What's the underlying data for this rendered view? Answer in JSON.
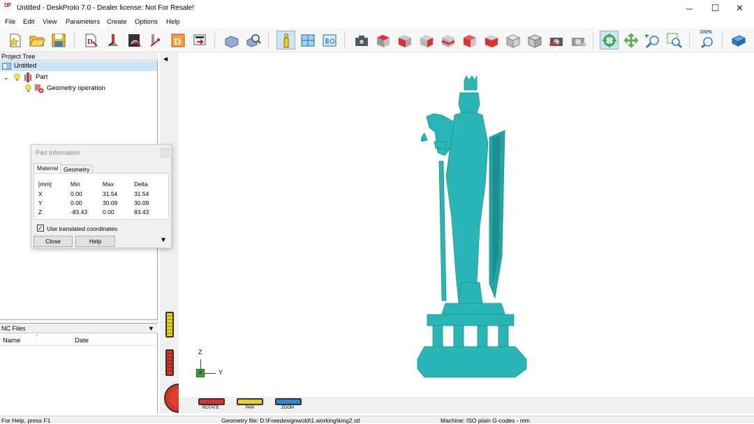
{
  "window": {
    "app_icon": "DP",
    "title": "Untitled - DeskProto 7.0 - Dealer license: Not For Resale!",
    "minimize": "─",
    "maximize": "☐",
    "close": "✕"
  },
  "menu": [
    "File",
    "Edit",
    "View",
    "Parameters",
    "Create",
    "Options",
    "Help"
  ],
  "toolbar": {
    "groups": [
      [
        "new-project-icon",
        "open-icon",
        "save-icon"
      ],
      [
        "wizard-icon",
        "wizard-2d-icon",
        "wizard-3d-icon",
        "wizard-rotary-icon",
        "decor-icon",
        "send-icon"
      ],
      [
        "part-icon",
        "find-icon"
      ],
      [
        "info-icon",
        "layout-icon",
        "window-icon"
      ],
      [
        "camera-icon",
        "view-top-icon",
        "view-front-icon",
        "view-left-icon",
        "view-right-icon",
        "view-back-icon",
        "view-bottom-icon",
        "view-iso-icon",
        "view-iso-2-icon",
        "view-previous-icon",
        "view-next-icon"
      ],
      [
        "rotate-icon",
        "pan-icon",
        "zoom-in-icon",
        "zoom-window-icon"
      ],
      [
        "zoom-100-icon"
      ],
      [
        "help-book-icon"
      ]
    ],
    "zoom_label": "100%",
    "active_icon": "info-icon"
  },
  "project_tree": {
    "header": "Project Tree",
    "root": "Untitled",
    "part": "Part",
    "operation": "Geometry operation"
  },
  "nc_files": {
    "header": "NC Files",
    "col_name": "Name",
    "col_date": "Date"
  },
  "part_info": {
    "title": "Part Information",
    "tabs": [
      "Material",
      "Geometry"
    ],
    "active_tab": "Material",
    "columns": [
      "[mm]",
      "Min",
      "Max",
      "Delta"
    ],
    "rows": [
      {
        "axis": "X",
        "min": "0.00",
        "max": "31.54",
        "delta": "31.54"
      },
      {
        "axis": "Y",
        "min": "0.00",
        "max": "30.09",
        "delta": "30.09"
      },
      {
        "axis": "Z",
        "min": "-83.43",
        "max": "0.00",
        "delta": "83.43"
      }
    ],
    "checkbox_label": "Use translated coordinates",
    "checkbox_checked": true,
    "close_button": "Close",
    "help_button": "Help"
  },
  "viewport": {
    "model_color": "#2ab6b6",
    "axis_z": "Z",
    "axis_x": "X",
    "axis_y": "Y",
    "mode_buttons": [
      "ROTATE",
      "PAN",
      "ZOOM"
    ],
    "mode_colors": [
      "#d8322a",
      "#e8d21a",
      "#2a86d6"
    ]
  },
  "statusbar": {
    "help": "For Help, press F1",
    "geometry_file": "Geometry file: D:\\Freedesignwold\\1.working\\king2.stl",
    "machine": "Machine: ISO plain G-codes - mm"
  }
}
